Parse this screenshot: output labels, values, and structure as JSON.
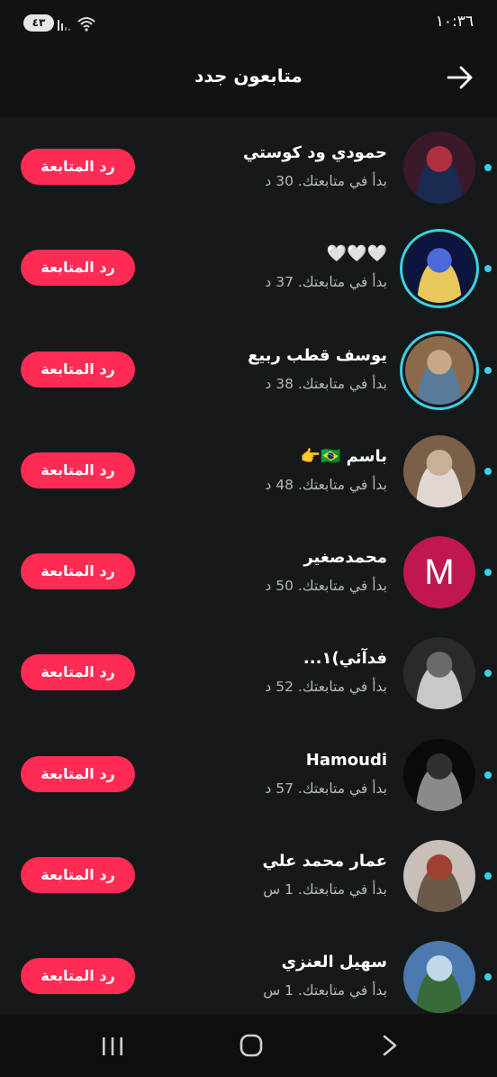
{
  "status": {
    "time": "١٠:٣٦",
    "battery": "٤٣"
  },
  "header": {
    "title": "متابعون جدد"
  },
  "follow_button_label": "رد المتابعة",
  "followers": [
    {
      "name": "حمودي ود كوستي",
      "sub": "بدأ في متابعتك. 30 د",
      "icon": "avatar-football-team",
      "ring": false
    },
    {
      "name": "🤍🤍🤍",
      "sub": "بدأ في متابعتك. 37 د",
      "icon": "avatar-night-bridge",
      "ring": true
    },
    {
      "name": "يوسف قطب ربيع",
      "sub": "بدأ في متابعتك. 38 د",
      "icon": "avatar-man-with-children",
      "ring": true
    },
    {
      "name": "باسم 🇧🇷👉",
      "sub": "بدأ في متابعتك. 48 د",
      "icon": "avatar-young-man",
      "ring": false
    },
    {
      "name": "محمدصغير",
      "sub": "بدأ في متابعتك. 50 د",
      "icon": "avatar-letter-m",
      "letter": "M",
      "ring": false
    },
    {
      "name": "فدآئي)١...",
      "sub": "بدأ في متابعتك. 52 د",
      "icon": "avatar-masked-figure",
      "ring": false
    },
    {
      "name": "Hamoudi",
      "sub": "بدأ في متابعتك. 57 د",
      "icon": "avatar-football-player",
      "ring": false
    },
    {
      "name": "عمار محمد علي",
      "sub": "بدأ في متابعتك. 1 س",
      "icon": "avatar-man-with-flags",
      "ring": false
    },
    {
      "name": "سهيل العنزي",
      "sub": "بدأ في متابعتك. 1 س",
      "icon": "avatar-young-man-outdoors",
      "ring": false
    }
  ],
  "nav": {
    "recent": "recent-apps-icon",
    "home": "home-icon",
    "back": "back-chevron-icon"
  }
}
